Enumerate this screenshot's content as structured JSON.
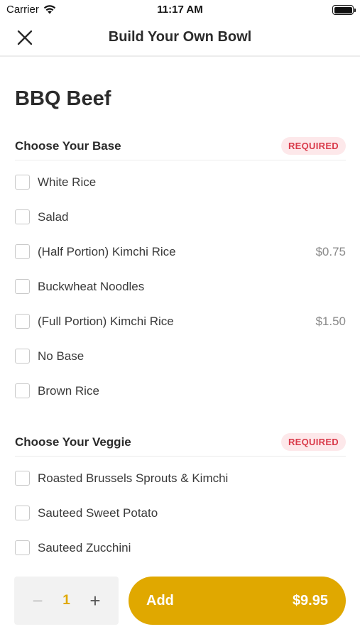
{
  "status_bar": {
    "carrier": "Carrier",
    "time": "11:17 AM",
    "battery_level": 1.0
  },
  "nav": {
    "title": "Build Your Own Bowl",
    "close_icon": "close-icon"
  },
  "item": {
    "name": "BBQ Beef"
  },
  "sections": [
    {
      "title": "Choose Your Base",
      "badge": "REQUIRED",
      "options": [
        {
          "label": "White Rice",
          "price": "",
          "checked": false
        },
        {
          "label": "Salad",
          "price": "",
          "checked": false
        },
        {
          "label": "(Half Portion) Kimchi Rice",
          "price": "$0.75",
          "checked": false
        },
        {
          "label": "Buckwheat Noodles",
          "price": "",
          "checked": false
        },
        {
          "label": "(Full Portion) Kimchi Rice",
          "price": "$1.50",
          "checked": false
        },
        {
          "label": "No Base",
          "price": "",
          "checked": false
        },
        {
          "label": "Brown Rice",
          "price": "",
          "checked": false
        }
      ]
    },
    {
      "title": "Choose Your Veggie",
      "badge": "REQUIRED",
      "options": [
        {
          "label": "Roasted Brussels Sprouts & Kimchi",
          "price": "",
          "checked": false
        },
        {
          "label": "Sauteed Sweet Potato",
          "price": "",
          "checked": false
        },
        {
          "label": "Sauteed Zucchini",
          "price": "",
          "checked": false
        }
      ]
    }
  ],
  "footer": {
    "quantity": "1",
    "minus_symbol": "−",
    "plus_symbol": "+",
    "add_label": "Add",
    "total_price": "$9.95"
  },
  "colors": {
    "accent": "#e0a800",
    "required_bg": "#fde8ea",
    "required_text": "#d93a4a"
  }
}
